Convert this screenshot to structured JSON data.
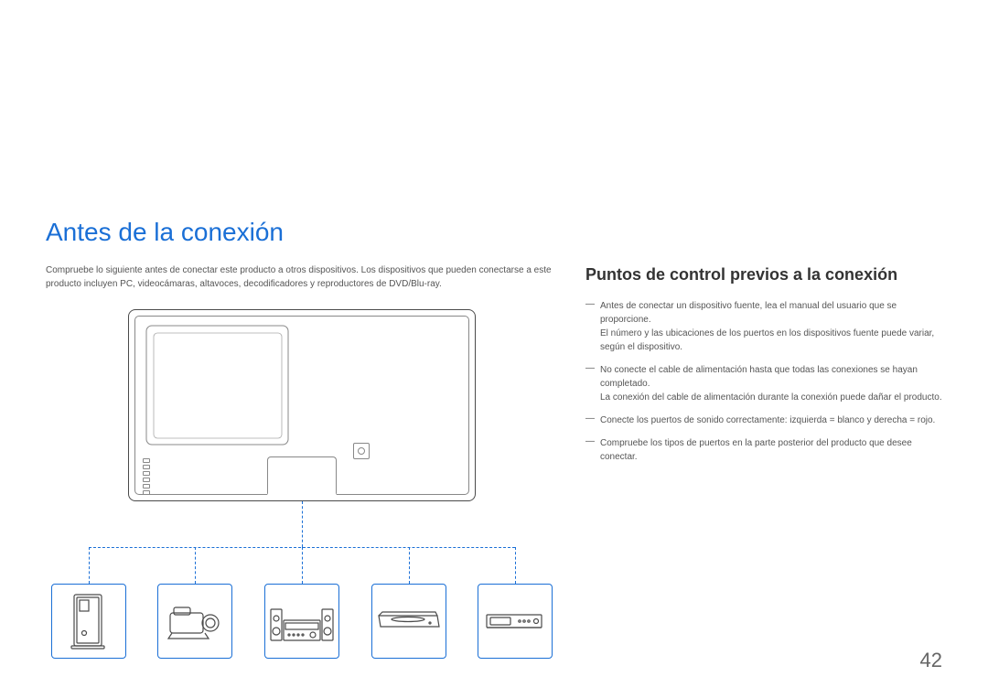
{
  "title": "Antes de la conexión",
  "intro": "Compruebe lo siguiente antes de conectar este producto a otros dispositivos. Los dispositivos que pueden conectarse a este producto incluyen PC, videocámaras, altavoces, decodificadores y reproductores de DVD/Blu-ray.",
  "subtitle": "Puntos de control previos a la conexión",
  "bullets": [
    {
      "main": "Antes de conectar un dispositivo fuente, lea el manual del usuario que se proporcione.",
      "sub": "El número y las ubicaciones de los puertos en los dispositivos fuente puede variar, según el dispositivo."
    },
    {
      "main": "No conecte el cable de alimentación hasta que todas las conexiones se hayan completado.",
      "sub": "La conexión del cable de alimentación durante la conexión puede dañar el producto."
    },
    {
      "main": "Conecte los puertos de sonido correctamente: izquierda = blanco y derecha = rojo.",
      "sub": ""
    },
    {
      "main": "Compruebe los tipos de puertos en la parte posterior del producto que desee conectar.",
      "sub": ""
    }
  ],
  "devices": [
    "pc-tower",
    "camcorder",
    "stereo-system",
    "dvd-player",
    "set-top-box"
  ],
  "page_number": "42"
}
